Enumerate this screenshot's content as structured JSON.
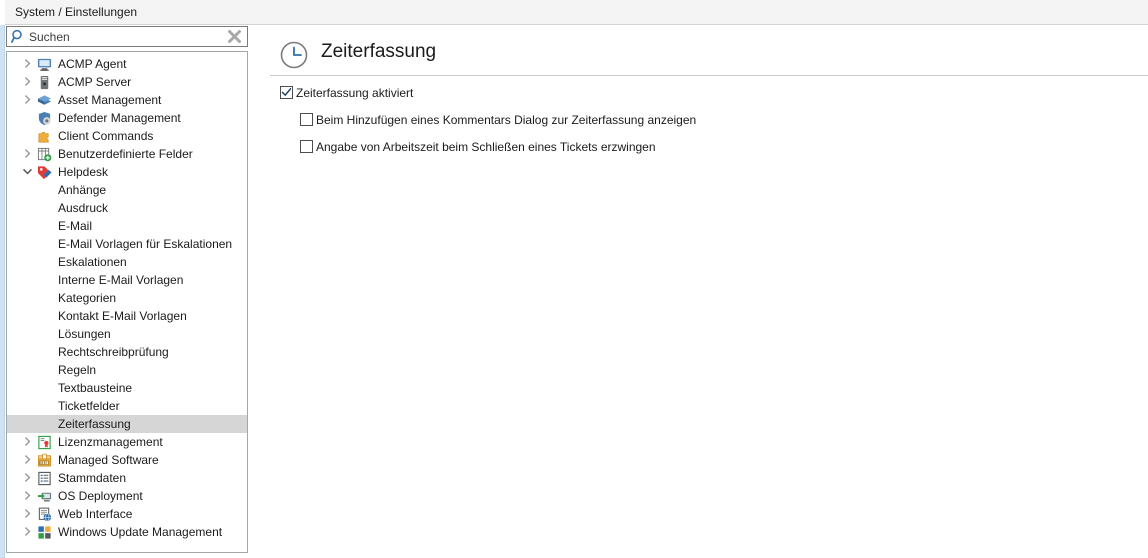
{
  "header": {
    "title": "System / Einstellungen"
  },
  "search": {
    "placeholder": "Suchen",
    "value": "",
    "icon": "search-icon",
    "clear_icon": "clear-icon"
  },
  "tree": {
    "items": [
      {
        "label": "ACMP Agent",
        "level": 0,
        "arrow": "collapsed",
        "icon": "monitor-icon",
        "selected": false
      },
      {
        "label": "ACMP Server",
        "level": 0,
        "arrow": "collapsed",
        "icon": "server-icon",
        "selected": false
      },
      {
        "label": "Asset Management",
        "level": 0,
        "arrow": "collapsed",
        "icon": "books-icon",
        "selected": false
      },
      {
        "label": "Defender Management",
        "level": 0,
        "arrow": "none",
        "icon": "shield-gear-icon",
        "selected": false
      },
      {
        "label": "Client Commands",
        "level": 0,
        "arrow": "none",
        "icon": "puzzle-icon",
        "selected": false
      },
      {
        "label": "Benutzerdefinierte Felder",
        "level": 0,
        "arrow": "collapsed",
        "icon": "table-plus-icon",
        "selected": false
      },
      {
        "label": "Helpdesk",
        "level": 0,
        "arrow": "expanded",
        "icon": "tag-icon",
        "selected": false
      },
      {
        "label": "Anhänge",
        "level": 1,
        "arrow": "none",
        "icon": "none",
        "selected": false
      },
      {
        "label": "Ausdruck",
        "level": 1,
        "arrow": "none",
        "icon": "none",
        "selected": false
      },
      {
        "label": "E-Mail",
        "level": 1,
        "arrow": "none",
        "icon": "none",
        "selected": false
      },
      {
        "label": "E-Mail Vorlagen für Eskalationen",
        "level": 1,
        "arrow": "none",
        "icon": "none",
        "selected": false
      },
      {
        "label": "Eskalationen",
        "level": 1,
        "arrow": "none",
        "icon": "none",
        "selected": false
      },
      {
        "label": "Interne E-Mail Vorlagen",
        "level": 1,
        "arrow": "none",
        "icon": "none",
        "selected": false
      },
      {
        "label": "Kategorien",
        "level": 1,
        "arrow": "none",
        "icon": "none",
        "selected": false
      },
      {
        "label": "Kontakt E-Mail Vorlagen",
        "level": 1,
        "arrow": "none",
        "icon": "none",
        "selected": false
      },
      {
        "label": "Lösungen",
        "level": 1,
        "arrow": "none",
        "icon": "none",
        "selected": false
      },
      {
        "label": "Rechtschreibprüfung",
        "level": 1,
        "arrow": "none",
        "icon": "none",
        "selected": false
      },
      {
        "label": "Regeln",
        "level": 1,
        "arrow": "none",
        "icon": "none",
        "selected": false
      },
      {
        "label": "Textbausteine",
        "level": 1,
        "arrow": "none",
        "icon": "none",
        "selected": false
      },
      {
        "label": "Ticketfelder",
        "level": 1,
        "arrow": "none",
        "icon": "none",
        "selected": false
      },
      {
        "label": "Zeiterfassung",
        "level": 1,
        "arrow": "none",
        "icon": "none",
        "selected": true
      },
      {
        "label": "Lizenzmanagement",
        "level": 0,
        "arrow": "collapsed",
        "icon": "license-icon",
        "selected": false
      },
      {
        "label": "Managed Software",
        "level": 0,
        "arrow": "collapsed",
        "icon": "package-icon",
        "selected": false
      },
      {
        "label": "Stammdaten",
        "level": 0,
        "arrow": "collapsed",
        "icon": "list-icon",
        "selected": false
      },
      {
        "label": "OS Deployment",
        "level": 0,
        "arrow": "collapsed",
        "icon": "deploy-icon",
        "selected": false
      },
      {
        "label": "Web Interface",
        "level": 0,
        "arrow": "collapsed",
        "icon": "web-icon",
        "selected": false
      },
      {
        "label": "Windows Update Management",
        "level": 0,
        "arrow": "collapsed",
        "icon": "windows-update-icon",
        "selected": false
      }
    ]
  },
  "content": {
    "title": "Zeiterfassung",
    "icon": "clock-icon",
    "options": [
      {
        "label": "Zeiterfassung aktiviert",
        "checked": true,
        "level": 0
      },
      {
        "label": "Beim Hinzufügen eines Kommentars Dialog zur Zeiterfassung anzeigen",
        "checked": false,
        "level": 1
      },
      {
        "label": "Angabe von Arbeitszeit beim Schließen eines Tickets erzwingen",
        "checked": false,
        "level": 1
      }
    ]
  },
  "colors": {
    "accent": "#2f6faf",
    "selection": "#d6d6d6",
    "header_bg": "#f4f4f4",
    "strip": "#cfe3f3"
  }
}
